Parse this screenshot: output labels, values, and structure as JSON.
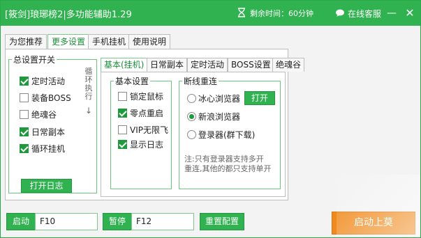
{
  "window": {
    "title": "[筱剑]琅琊榜2|多功能辅助1.29",
    "timer_text": "剩余时间：60分钟",
    "service_label": "在线客服",
    "min_symbol": "—",
    "close_symbol": "✕"
  },
  "tabs": [
    "为您推荐",
    "更多设置",
    "手机挂机",
    "使用说明"
  ],
  "active_tab": 1,
  "master": {
    "legend": "总设置开关",
    "items": [
      {
        "label": "定时活动",
        "checked": true
      },
      {
        "label": "装备BOSS",
        "checked": false
      },
      {
        "label": "绝魂谷",
        "checked": false
      },
      {
        "label": "日常副本",
        "checked": true
      },
      {
        "label": "循环挂机",
        "checked": true
      }
    ],
    "side_note": "循环执行",
    "arrow": "↓",
    "log_button": "打开日志"
  },
  "subtabs": [
    "基本(挂机)",
    "日常副本",
    "定时活动",
    "BOSS设置",
    "绝魂谷"
  ],
  "basic": {
    "legend": "基本设置",
    "items": [
      {
        "label": "锁定鼠标",
        "checked": false
      },
      {
        "label": "零点重启",
        "checked": true
      },
      {
        "label": "VIP无限飞",
        "checked": false
      },
      {
        "label": "显示日志",
        "checked": true
      }
    ]
  },
  "reconnect": {
    "legend": "断线重连",
    "options": [
      {
        "label": "冰心浏览器",
        "checked": false
      },
      {
        "label": "新浪浏览器",
        "checked": true
      },
      {
        "label": "登录器(群下载)",
        "checked": false
      }
    ],
    "open_button": "打开",
    "note_line1": "注:只有登录器支持多开",
    "note_line2": "重连,其他的都只支持单开"
  },
  "bottom": {
    "start_label": "启动",
    "start_key": "F10",
    "pause_label": "暂停",
    "pause_key": "F12",
    "reset_button": "重置配置",
    "launch_button": "启动上莫"
  },
  "colors": {
    "accent": "#2fb24f",
    "launch": "#f08a1c"
  }
}
